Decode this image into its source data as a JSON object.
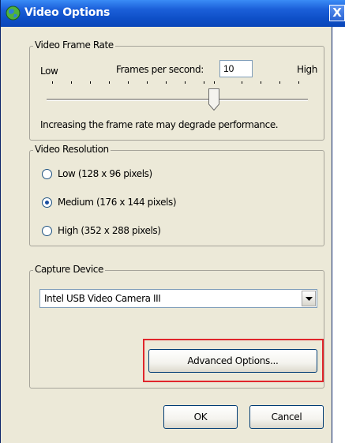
{
  "window": {
    "title": "Video Options",
    "close_glyph": "X"
  },
  "frame_rate": {
    "group_title": "Video Frame Rate",
    "low_label": "Low",
    "fps_label": "Frames per second:",
    "fps_value": "10",
    "high_label": "High",
    "slider_level_fraction": 0.65,
    "note": "Increasing the frame rate may degrade performance."
  },
  "resolution": {
    "group_title": "Video Resolution",
    "options": [
      {
        "label": "Low (128 x 96 pixels)",
        "checked": false
      },
      {
        "label": "Medium (176 x 144 pixels)",
        "checked": true
      },
      {
        "label": "High (352 x 288 pixels)",
        "checked": false
      }
    ]
  },
  "capture": {
    "group_title": "Capture Device",
    "selected_device": "Intel USB Video Camera III",
    "advanced_button": "Advanced Options..."
  },
  "footer": {
    "ok_button": "OK",
    "cancel_button": "Cancel"
  },
  "colors": {
    "titlebar": "#0e4fc7",
    "dialog_bg": "#ece9d8",
    "highlight": "#e0262c"
  },
  "icons": {
    "title_icon": "globe-camera-icon",
    "close_icon": "close-icon",
    "dropdown_icon": "chevron-down-icon"
  }
}
